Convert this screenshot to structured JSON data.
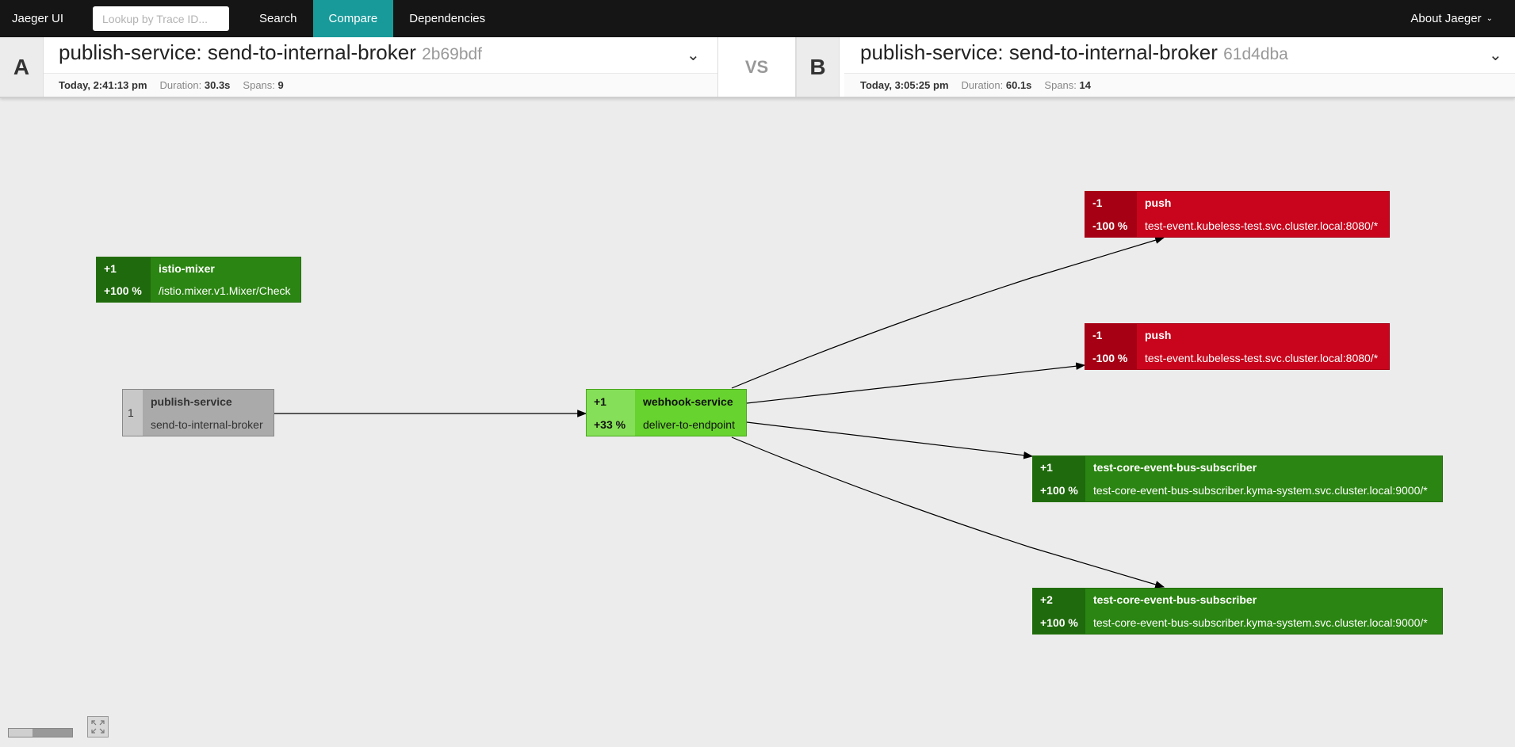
{
  "nav": {
    "brand": "Jaeger UI",
    "lookup_placeholder": "Lookup by Trace ID...",
    "links": [
      "Search",
      "Compare",
      "Dependencies"
    ],
    "active": "Compare",
    "about": "About Jaeger"
  },
  "trace_a": {
    "letter": "A",
    "title": "publish-service: send-to-internal-broker",
    "trace_id": "2b69bdf",
    "time": "Today, 2:41:13 pm",
    "duration_label": "Duration:",
    "duration": "30.3s",
    "spans_label": "Spans:",
    "spans": "9"
  },
  "vs_label": "VS",
  "trace_b": {
    "letter": "B",
    "title": "publish-service: send-to-internal-broker",
    "trace_id": "61d4dba",
    "time": "Today, 3:05:25 pm",
    "duration_label": "Duration:",
    "duration": "60.1s",
    "spans_label": "Spans:",
    "spans": "14"
  },
  "nodes": {
    "istio": {
      "delta": "+1",
      "pct": "+100 %",
      "service": "istio-mixer",
      "operation": "/istio.mixer.v1.Mixer/Check"
    },
    "publish": {
      "count": "1",
      "service": "publish-service",
      "operation": "send-to-internal-broker"
    },
    "webhook": {
      "delta": "+1",
      "pct": "+33 %",
      "service": "webhook-service",
      "operation": "deliver-to-endpoint"
    },
    "push1": {
      "delta": "-1",
      "pct": "-100 %",
      "service": "push",
      "operation": "test-event.kubeless-test.svc.cluster.local:8080/*"
    },
    "push2": {
      "delta": "-1",
      "pct": "-100 %",
      "service": "push",
      "operation": "test-event.kubeless-test.svc.cluster.local:8080/*"
    },
    "sub1": {
      "delta": "+1",
      "pct": "+100 %",
      "service": "test-core-event-bus-subscriber",
      "operation": "test-core-event-bus-subscriber.kyma-system.svc.cluster.local:9000/*"
    },
    "sub2": {
      "delta": "+2",
      "pct": "+100 %",
      "service": "test-core-event-bus-subscriber",
      "operation": "test-core-event-bus-subscriber.kyma-system.svc.cluster.local:9000/*"
    }
  },
  "colors": {
    "nav_bg": "#151515",
    "nav_active": "#199a9a",
    "added": "#2b8512",
    "removed": "#c8051c",
    "partial_added": "#67d32e",
    "unchanged": "#aaaaaa"
  }
}
